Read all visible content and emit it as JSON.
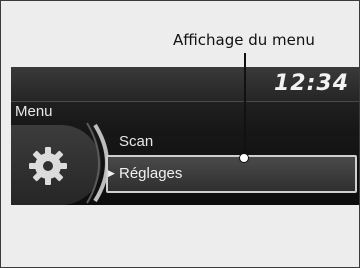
{
  "callout": {
    "label": "Affichage du menu"
  },
  "screen": {
    "clock": "12:34",
    "title": "Menu",
    "items": [
      {
        "label": "Scan",
        "selected": false
      },
      {
        "label": "Réglages",
        "selected": true
      }
    ],
    "settings_icon": "gear-icon"
  }
}
